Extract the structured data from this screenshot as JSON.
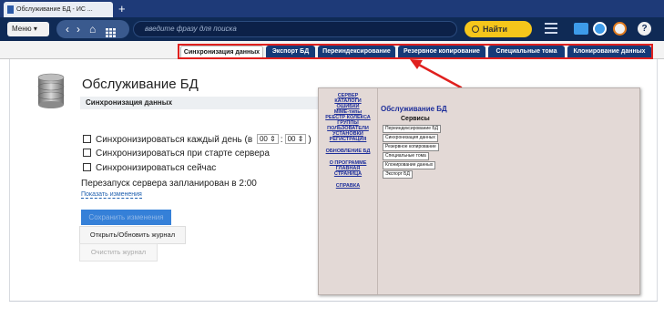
{
  "browser": {
    "tab_title": "Обслуживание БД - ИС ...",
    "new_tab": "+"
  },
  "toolbar": {
    "menu_label": "Меню ▾",
    "nav_back": "‹",
    "nav_forward": "›",
    "nav_home": "⌂",
    "search_placeholder": "введите фразу для поиска",
    "find_label": "Найти",
    "help_label": "?"
  },
  "tabs": [
    {
      "label": "Синхронизация данных",
      "active": true
    },
    {
      "label": "Экспорт БД",
      "active": false
    },
    {
      "label": "Переиндексирование",
      "active": false
    },
    {
      "label": "Резервное копирование",
      "active": false
    },
    {
      "label": "Специальные тома",
      "active": false
    },
    {
      "label": "Клонирование данных",
      "active": false
    }
  ],
  "main": {
    "title": "Обслуживание БД",
    "section": "Синхронизация данных",
    "sync_daily_prefix": "Синхронизироваться каждый день (в",
    "sync_hour": "00",
    "sync_sep": ":",
    "sync_min": "00",
    "sync_daily_suffix": ")",
    "sync_on_start": "Синхронизироваться при старте сервера",
    "sync_now": "Синхронизироваться сейчас",
    "restart_text": "Перезапуск сервера запланирован в 2:00",
    "show_changes": "Показать изменения",
    "save_button": "Сохранить изменения",
    "log_button": "Открыть/Обновить журнал",
    "clear_button": "Очистить журнал"
  },
  "inset": {
    "nav": [
      "СЕРВЕР",
      "КАТАЛОГИ",
      "ОШИБКИ",
      "MIME-типы",
      "РЕЕСТР КОЛЕКСА",
      "ГРУППЫ",
      "ПОЛЬЗОВАТЕЛИ",
      "УСТАНОВКИ",
      "РЕГИСТРАЦИЯ",
      "ОБНОВЛЕНИЕ БД",
      "О ПРОГРАММЕ",
      "ГЛАВНАЯ",
      "СТРАНИЦА",
      "СПРАВКА"
    ],
    "title": "Обслуживание БД",
    "services": "Сервисы",
    "buttons": [
      "Переиндексирование БД",
      "Синхронизация данных",
      "Резервное копирование",
      "Специальные тома",
      "Клонирование данных",
      "Экспорт БД"
    ]
  },
  "colors": {
    "toolbar_bg": "#0f2a55",
    "tab_bg": "#163a78",
    "find_button": "#f5c61b",
    "highlight_red": "#e0201e",
    "save_button": "#3580d8",
    "inset_bg": "#e3d9d6",
    "inset_link": "#1d2e9a"
  }
}
